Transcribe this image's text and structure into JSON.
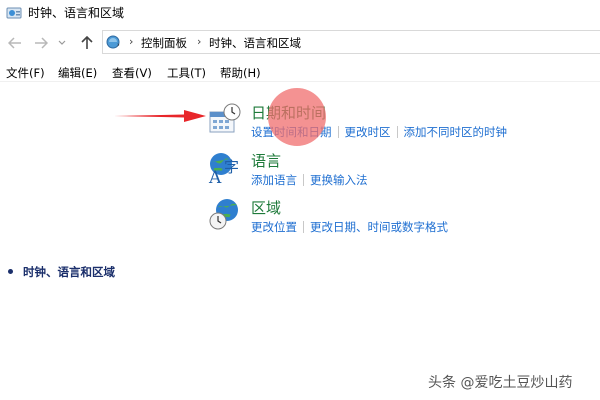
{
  "window": {
    "title": "时钟、语言和区域",
    "icon": "control-panel-icon"
  },
  "nav": {
    "back_icon": "back-arrow-icon",
    "forward_icon": "forward-arrow-icon",
    "recent_icon": "chevron-down-icon",
    "up_icon": "up-arrow-icon"
  },
  "address_bar": {
    "breadcrumbs": [
      "控制面板",
      "时钟、语言和区域"
    ]
  },
  "menu": [
    "文件(F)",
    "编辑(E)",
    "查看(V)",
    "工具(T)",
    "帮助(H)"
  ],
  "categories": [
    {
      "heading": "日期和时间",
      "icon": "calendar-clock-icon",
      "links": [
        "设置时间和日期",
        "更改时区",
        "添加不同时区的时钟"
      ]
    },
    {
      "heading": "语言",
      "icon": "language-icon",
      "links": [
        "添加语言",
        "更换输入法"
      ]
    },
    {
      "heading": "区域",
      "icon": "globe-clock-icon",
      "links": [
        "更改位置",
        "更改日期、时间或数字格式"
      ]
    }
  ],
  "sidebar": {
    "items": [
      "时钟、语言和区域"
    ]
  },
  "annotations": {
    "arrow_color": "#e8262a",
    "highlight_color": "#f06e6e"
  },
  "watermark": "头条 @爱吃土豆炒山药"
}
